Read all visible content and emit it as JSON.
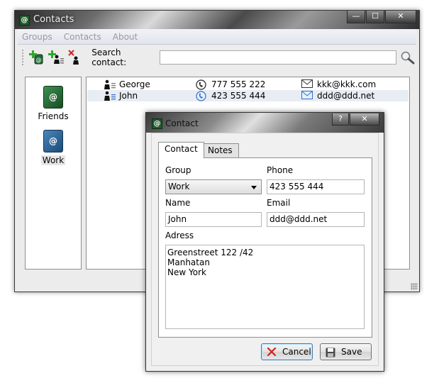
{
  "main_window": {
    "title": "Contacts",
    "title_icon_glyph": "@",
    "controls": {
      "minimize": "—",
      "maximize": "☐",
      "close": "✕"
    }
  },
  "menu": [
    "Groups",
    "Contacts",
    "About"
  ],
  "toolbar": {
    "icons": [
      "add-group-icon",
      "add-contact-icon",
      "delete-contact-icon"
    ],
    "search_label": "Search contact:",
    "search_value": "",
    "search_icon": "magnifier-icon"
  },
  "groups": [
    {
      "name": "Friends",
      "icon": "green-address-book-icon",
      "glyph": "@",
      "selected": false
    },
    {
      "name": "Work",
      "icon": "blue-address-book-icon",
      "glyph": "@",
      "selected": true
    }
  ],
  "contacts": [
    {
      "name": "George",
      "phone": "777 555 222",
      "email": "kkk@kkk.com",
      "selected": false
    },
    {
      "name": "John",
      "phone": "423 555 444",
      "email": "ddd@ddd.net",
      "selected": true
    }
  ],
  "dialog": {
    "title": "Contact",
    "title_icon_glyph": "@",
    "controls": {
      "help": "?",
      "close": "✕"
    },
    "tabs": [
      "Contact",
      "Notes"
    ],
    "active_tab": "Contact",
    "fields": {
      "group_label": "Group",
      "group_value": "Work",
      "phone_label": "Phone",
      "phone_value": "423 555 444",
      "name_label": "Name",
      "name_value": "John",
      "email_label": "Email",
      "email_value": "ddd@ddd.net",
      "address_label": "Adress",
      "address_lines": [
        "Greenstreet 122 /42",
        "Manhatan",
        "New York"
      ]
    },
    "buttons": {
      "cancel": "Cancel",
      "save": "Save"
    }
  },
  "colors": {
    "accent_green": "#1f5a2a",
    "selection_row": "#e8ecf3",
    "delete_red": "#d42020",
    "mail_blue": "#2f6fc9"
  }
}
